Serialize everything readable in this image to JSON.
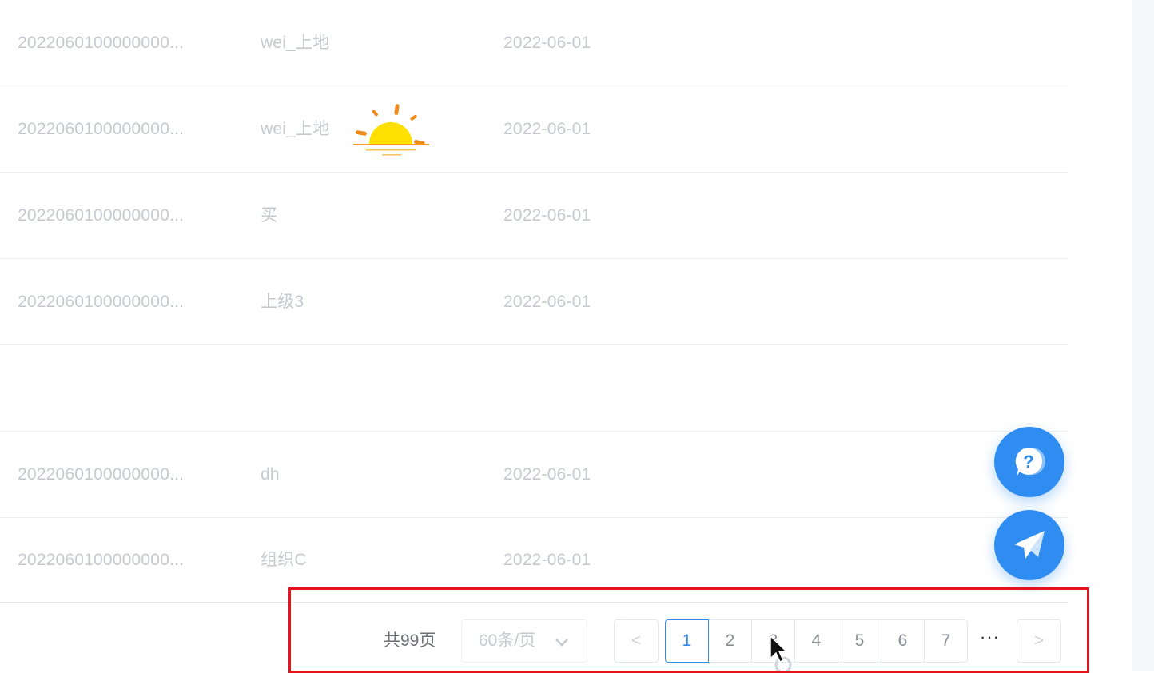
{
  "table": {
    "rows": [
      {
        "id": "2022060100000000...",
        "name": "wei_上地",
        "date": "2022-06-01"
      },
      {
        "id": "2022060100000000...",
        "name": "wei_上地",
        "date": "2022-06-01"
      },
      {
        "id": "2022060100000000...",
        "name": "买",
        "date": "2022-06-01"
      },
      {
        "id": "2022060100000000...",
        "name": "上级3",
        "date": "2022-06-01"
      },
      {
        "id": "",
        "name": "",
        "date": ""
      },
      {
        "id": "2022060100000000...",
        "name": "dh",
        "date": "2022-06-01"
      },
      {
        "id": "2022060100000000...",
        "name": "组织C",
        "date": "2022-06-01"
      }
    ]
  },
  "floating_buttons": {
    "help_icon": "question-bubble-icon",
    "send_icon": "paper-plane-icon",
    "color": "#2f8df2"
  },
  "pagination": {
    "total_text": "共99页",
    "page_size": "60条/页",
    "prev_label": "<",
    "next_label": ">",
    "pages": [
      "1",
      "2",
      "3",
      "4",
      "5",
      "6",
      "7"
    ],
    "current_page": "1",
    "ellipsis": "···",
    "highlight_color": "#e5131b"
  }
}
